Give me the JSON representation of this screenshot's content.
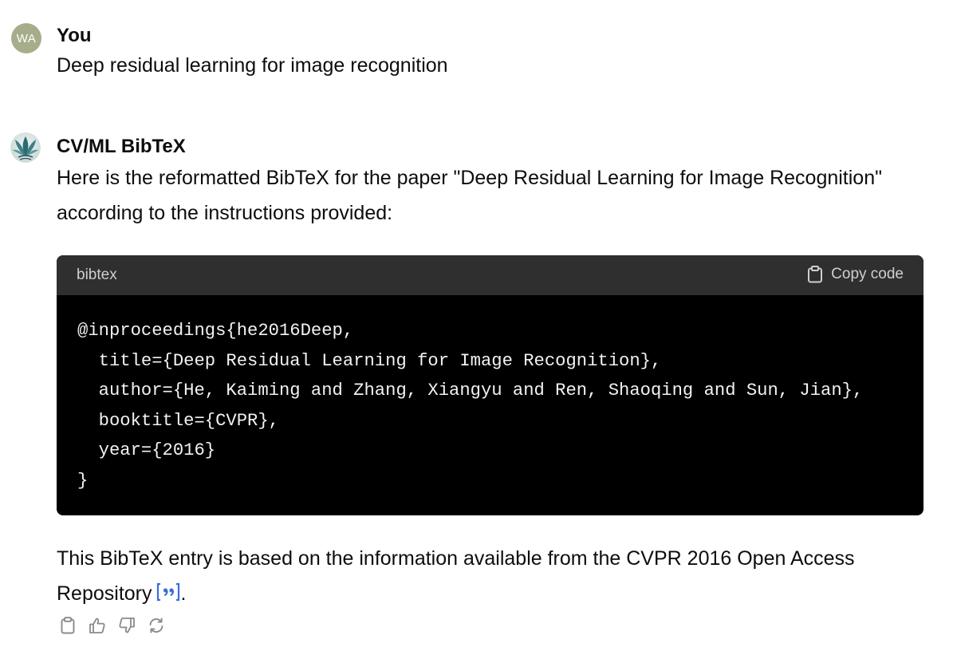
{
  "user": {
    "avatar_initials": "WA",
    "name": "You",
    "message": "Deep residual learning for image recognition"
  },
  "assistant": {
    "name": "CV/ML BibTeX",
    "intro": "Here is the reformatted BibTeX for the paper \"Deep Residual Learning for Image Recognition\" according to the instructions provided:",
    "code_block": {
      "language": "bibtex",
      "copy_label": "Copy code",
      "lines": [
        "@inproceedings{he2016Deep,",
        "  title={Deep Residual Learning for Image Recognition},",
        "  author={He, Kaiming and Zhang, Xiangyu and Ren, Shaoqing and Sun, Jian},",
        "  booktitle={CVPR},",
        "  year={2016}",
        "}"
      ]
    },
    "outro": "This BibTeX entry is based on the information available from the CVPR 2016 Open Access Repository",
    "outro_end": ".",
    "citation_icon": "quote-citation-icon",
    "actions": [
      "copy-icon",
      "thumbs-up-icon",
      "thumbs-down-icon",
      "regenerate-icon"
    ]
  },
  "colors": {
    "user_avatar_bg": "#a6ad8b",
    "code_header_bg": "#2f2f2f",
    "code_body_bg": "#000000",
    "citation_blue": "#3b6fd4"
  }
}
